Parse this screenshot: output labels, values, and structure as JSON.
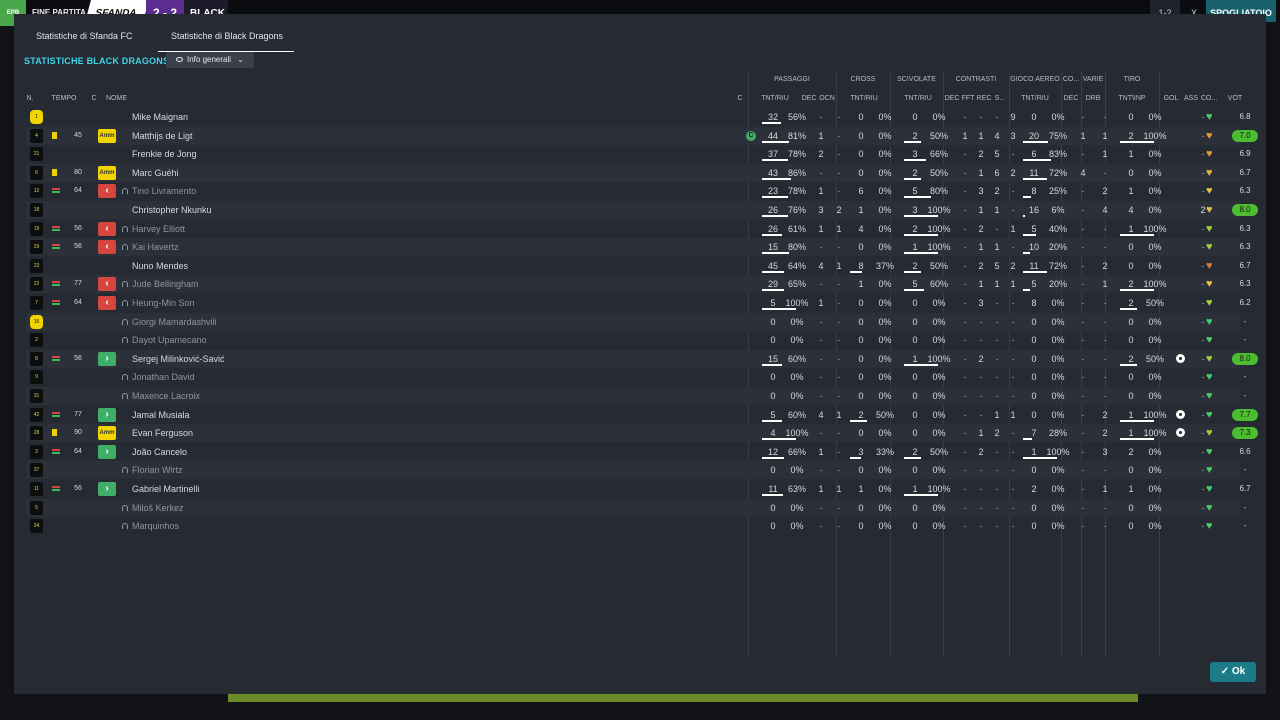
{
  "topbar": {
    "logo": "EPB",
    "status": "FINE PARTITA",
    "home": "SFANDA",
    "score": "2 - 2",
    "away": "BLACK",
    "right_score": "1-2",
    "right_x": "X",
    "right_button": "SPOGLIATOIO"
  },
  "tabs": [
    {
      "label": "Statistiche di Sfanda FC"
    },
    {
      "label": "Statistiche di Black Dragons"
    }
  ],
  "team_title": "STATISTICHE BLACK DRAGONS",
  "dropdown": {
    "label": "Info generali"
  },
  "groups": [
    "PASSAGGI",
    "CROSS",
    "SCIVOLATE",
    "CONTRASTI",
    "GIOCO AEREO",
    "CO...",
    "VARIE",
    "TIRO"
  ],
  "headers": [
    "N.",
    "TEMPO",
    "C",
    "NOME",
    "C",
    "TNT/RIU",
    "DEC",
    "OCN",
    "TNT/RIU",
    "TNT/RIU",
    "DEC",
    "FFT",
    "REC",
    "S...",
    "TNT/RIU",
    "DEC",
    "DRB",
    "TNT\\INP",
    "GOL",
    "ASS",
    "CO...",
    "VOT"
  ],
  "players": [
    {
      "num": "1",
      "gk": true,
      "card": "",
      "sub": "",
      "tempo": "",
      "badge": "",
      "name": "Mike Maignan",
      "dim": false,
      "cap": false,
      "pas": [
        "32",
        "56%"
      ],
      "pasr": 0.56,
      "dec": "-",
      "ocn": "-",
      "cr": [
        "0",
        "0%"
      ],
      "crr": 0,
      "sc": [
        "0",
        "0%"
      ],
      "scr": 0,
      "cdec": "-",
      "fft": "-",
      "rec": "-",
      "s": "9",
      "ga": [
        "0",
        "0%"
      ],
      "gar": 0,
      "co": "-",
      "drb": "-",
      "ti": [
        "0",
        "0%"
      ],
      "tir": 0,
      "gol": "",
      "ass": "-",
      "heart": "#3fd06a",
      "vot": "6.8",
      "hi": false
    },
    {
      "num": "4",
      "gk": false,
      "card": "y",
      "sub": "",
      "tempo": "45",
      "badge": "amm",
      "name": "Matthijs de Ligt",
      "dim": false,
      "cap": true,
      "pas": [
        "44",
        "81%"
      ],
      "pasr": 0.81,
      "dec": "1",
      "ocn": "-",
      "cr": [
        "0",
        "0%"
      ],
      "crr": 0,
      "sc": [
        "2",
        "50%"
      ],
      "scr": 0.5,
      "cdec": "1",
      "fft": "1",
      "rec": "4",
      "s": "3",
      "ga": [
        "20",
        "75%"
      ],
      "gar": 0.75,
      "co": "1",
      "drb": "1",
      "ti": [
        "2",
        "100%"
      ],
      "tir": 1,
      "gol": "",
      "ass": "-",
      "heart": "#e39a3a",
      "vot": "7.0",
      "hi": true
    },
    {
      "num": "21",
      "gk": false,
      "card": "",
      "sub": "",
      "tempo": "",
      "badge": "",
      "name": "Frenkie de Jong",
      "dim": false,
      "cap": false,
      "pas": [
        "37",
        "78%"
      ],
      "pasr": 0.78,
      "dec": "2",
      "ocn": "-",
      "cr": [
        "0",
        "0%"
      ],
      "crr": 0,
      "sc": [
        "3",
        "66%"
      ],
      "scr": 0.66,
      "cdec": "-",
      "fft": "2",
      "rec": "5",
      "s": "-",
      "ga": [
        "6",
        "83%"
      ],
      "gar": 0.83,
      "co": "-",
      "drb": "1",
      "ti": [
        "1",
        "0%"
      ],
      "tir": 0,
      "gol": "",
      "ass": "-",
      "heart": "#e39a3a",
      "vot": "6.9",
      "hi": false
    },
    {
      "num": "6",
      "gk": false,
      "card": "y",
      "sub": "",
      "tempo": "80",
      "badge": "amm",
      "name": "Marc Guéhi",
      "dim": false,
      "cap": false,
      "pas": [
        "43",
        "86%"
      ],
      "pasr": 0.86,
      "dec": "-",
      "ocn": "-",
      "cr": [
        "0",
        "0%"
      ],
      "crr": 0,
      "sc": [
        "2",
        "50%"
      ],
      "scr": 0.5,
      "cdec": "-",
      "fft": "1",
      "rec": "6",
      "s": "2",
      "ga": [
        "11",
        "72%"
      ],
      "gar": 0.72,
      "co": "4",
      "drb": "-",
      "ti": [
        "0",
        "0%"
      ],
      "tir": 0,
      "gol": "",
      "ass": "-",
      "heart": "#e3b23a",
      "vot": "6.7",
      "hi": false
    },
    {
      "num": "12",
      "gk": false,
      "card": "",
      "sub": "s",
      "tempo": "64",
      "badge": "out",
      "name": "Tino Livramento",
      "dim": true,
      "cap": false,
      "pas": [
        "23",
        "78%"
      ],
      "pasr": 0.78,
      "dec": "1",
      "ocn": "-",
      "cr": [
        "6",
        "0%"
      ],
      "crr": 0,
      "sc": [
        "5",
        "80%"
      ],
      "scr": 0.8,
      "cdec": "-",
      "fft": "3",
      "rec": "2",
      "s": "-",
      "ga": [
        "8",
        "25%"
      ],
      "gar": 0.25,
      "co": "-",
      "drb": "2",
      "ti": [
        "1",
        "0%"
      ],
      "tir": 0,
      "gol": "",
      "ass": "-",
      "heart": "#e3c23a",
      "vot": "6.3",
      "hi": false
    },
    {
      "num": "18",
      "gk": false,
      "card": "",
      "sub": "",
      "tempo": "",
      "badge": "",
      "name": "Christopher Nkunku",
      "dim": false,
      "cap": false,
      "pas": [
        "26",
        "76%"
      ],
      "pasr": 0.76,
      "dec": "3",
      "ocn": "2",
      "cr": [
        "1",
        "0%"
      ],
      "crr": 0,
      "sc": [
        "3",
        "100%"
      ],
      "scr": 1,
      "cdec": "-",
      "fft": "1",
      "rec": "1",
      "s": "-",
      "ga": [
        "16",
        "6%"
      ],
      "gar": 0.06,
      "co": "-",
      "drb": "4",
      "ti": [
        "4",
        "0%"
      ],
      "tir": 0,
      "gol": "",
      "ass": "2",
      "heart": "#e3c23a",
      "vot": "8.0",
      "hi": true
    },
    {
      "num": "19",
      "gk": false,
      "card": "",
      "sub": "s",
      "tempo": "56",
      "badge": "out",
      "name": "Harvey Elliott",
      "dim": true,
      "cap": false,
      "pas": [
        "26",
        "61%"
      ],
      "pasr": 0.61,
      "dec": "1",
      "ocn": "1",
      "cr": [
        "4",
        "0%"
      ],
      "crr": 0,
      "sc": [
        "2",
        "100%"
      ],
      "scr": 1,
      "cdec": "-",
      "fft": "2",
      "rec": "-",
      "s": "1",
      "ga": [
        "5",
        "40%"
      ],
      "gar": 0.4,
      "co": "-",
      "drb": "-",
      "ti": [
        "1",
        "100%"
      ],
      "tir": 1,
      "gol": "",
      "ass": "-",
      "heart": "#9ed23a",
      "vot": "6.3",
      "hi": false
    },
    {
      "num": "29",
      "gk": false,
      "card": "",
      "sub": "s",
      "tempo": "56",
      "badge": "out",
      "name": "Kai Havertz",
      "dim": true,
      "cap": false,
      "pas": [
        "15",
        "80%"
      ],
      "pasr": 0.8,
      "dec": "-",
      "ocn": "-",
      "cr": [
        "0",
        "0%"
      ],
      "crr": 0,
      "sc": [
        "1",
        "100%"
      ],
      "scr": 1,
      "cdec": "-",
      "fft": "1",
      "rec": "1",
      "s": "-",
      "ga": [
        "10",
        "20%"
      ],
      "gar": 0.2,
      "co": "-",
      "drb": "-",
      "ti": [
        "0",
        "0%"
      ],
      "tir": 0,
      "gol": "",
      "ass": "-",
      "heart": "#9ed23a",
      "vot": "6.3",
      "hi": false
    },
    {
      "num": "23",
      "gk": false,
      "card": "",
      "sub": "",
      "tempo": "",
      "badge": "",
      "name": "Nuno Mendes",
      "dim": false,
      "cap": false,
      "pas": [
        "45",
        "64%"
      ],
      "pasr": 0.64,
      "dec": "4",
      "ocn": "1",
      "cr": [
        "8",
        "37%"
      ],
      "crr": 0.37,
      "sc": [
        "2",
        "50%"
      ],
      "scr": 0.5,
      "cdec": "-",
      "fft": "2",
      "rec": "5",
      "s": "2",
      "ga": [
        "11",
        "72%"
      ],
      "gar": 0.72,
      "co": "-",
      "drb": "2",
      "ti": [
        "0",
        "0%"
      ],
      "tir": 0,
      "gol": "",
      "ass": "-",
      "heart": "#d27a3a",
      "vot": "6.7",
      "hi": false
    },
    {
      "num": "22",
      "gk": false,
      "card": "",
      "sub": "s",
      "tempo": "77",
      "badge": "out",
      "name": "Jude Bellingham",
      "dim": true,
      "cap": false,
      "pas": [
        "29",
        "65%"
      ],
      "pasr": 0.65,
      "dec": "-",
      "ocn": "-",
      "cr": [
        "1",
        "0%"
      ],
      "crr": 0,
      "sc": [
        "5",
        "60%"
      ],
      "scr": 0.6,
      "cdec": "-",
      "fft": "1",
      "rec": "1",
      "s": "1",
      "ga": [
        "5",
        "20%"
      ],
      "gar": 0.2,
      "co": "-",
      "drb": "1",
      "ti": [
        "2",
        "100%"
      ],
      "tir": 1,
      "gol": "",
      "ass": "-",
      "heart": "#e3c23a",
      "vot": "6.3",
      "hi": false
    },
    {
      "num": "7",
      "gk": false,
      "card": "",
      "sub": "s",
      "tempo": "64",
      "badge": "out",
      "name": "Heung-Min Son",
      "dim": true,
      "cap": false,
      "pas": [
        "5",
        "100%"
      ],
      "pasr": 1,
      "dec": "1",
      "ocn": "-",
      "cr": [
        "0",
        "0%"
      ],
      "crr": 0,
      "sc": [
        "0",
        "0%"
      ],
      "scr": 0,
      "cdec": "-",
      "fft": "3",
      "rec": "-",
      "s": "-",
      "ga": [
        "8",
        "0%"
      ],
      "gar": 0,
      "co": "-",
      "drb": "-",
      "ti": [
        "2",
        "50%"
      ],
      "tir": 0.5,
      "gol": "",
      "ass": "-",
      "heart": "#9ed23a",
      "vot": "6.2",
      "hi": false
    },
    {
      "num": "16",
      "gk": true,
      "card": "",
      "sub": "",
      "tempo": "",
      "badge": "",
      "name": "Giorgi Mamardashvili",
      "dim": true,
      "cap": false,
      "pas": [
        "0",
        "0%"
      ],
      "pasr": 0,
      "dec": "-",
      "ocn": "-",
      "cr": [
        "0",
        "0%"
      ],
      "crr": 0,
      "sc": [
        "0",
        "0%"
      ],
      "scr": 0,
      "cdec": "-",
      "fft": "-",
      "rec": "-",
      "s": "-",
      "ga": [
        "0",
        "0%"
      ],
      "gar": 0,
      "co": "-",
      "drb": "-",
      "ti": [
        "0",
        "0%"
      ],
      "tir": 0,
      "gol": "",
      "ass": "-",
      "heart": "#3fd06a",
      "vot": "-",
      "hi": false
    },
    {
      "num": "2",
      "gk": false,
      "card": "",
      "sub": "",
      "tempo": "",
      "badge": "",
      "name": "Dayot Upamecano",
      "dim": true,
      "cap": false,
      "pas": [
        "0",
        "0%"
      ],
      "pasr": 0,
      "dec": "-",
      "ocn": "-",
      "cr": [
        "0",
        "0%"
      ],
      "crr": 0,
      "sc": [
        "0",
        "0%"
      ],
      "scr": 0,
      "cdec": "-",
      "fft": "-",
      "rec": "-",
      "s": "-",
      "ga": [
        "0",
        "0%"
      ],
      "gar": 0,
      "co": "-",
      "drb": "-",
      "ti": [
        "0",
        "0%"
      ],
      "tir": 0,
      "gol": "",
      "ass": "-",
      "heart": "#3fd06a",
      "vot": "-",
      "hi": false
    },
    {
      "num": "8",
      "gk": false,
      "card": "",
      "sub": "i",
      "tempo": "56",
      "badge": "in",
      "name": "Sergej Milinković-Savić",
      "dim": false,
      "cap": false,
      "pas": [
        "15",
        "60%"
      ],
      "pasr": 0.6,
      "dec": "-",
      "ocn": "-",
      "cr": [
        "0",
        "0%"
      ],
      "crr": 0,
      "sc": [
        "1",
        "100%"
      ],
      "scr": 1,
      "cdec": "-",
      "fft": "2",
      "rec": "-",
      "s": "-",
      "ga": [
        "0",
        "0%"
      ],
      "gar": 0,
      "co": "-",
      "drb": "-",
      "ti": [
        "2",
        "50%"
      ],
      "tir": 0.5,
      "gol": "1",
      "ass": "-",
      "heart": "#9ed23a",
      "vot": "8.0",
      "hi": true
    },
    {
      "num": "9",
      "gk": false,
      "card": "",
      "sub": "",
      "tempo": "",
      "badge": "",
      "name": "Jonathan David",
      "dim": true,
      "cap": false,
      "pas": [
        "0",
        "0%"
      ],
      "pasr": 0,
      "dec": "-",
      "ocn": "-",
      "cr": [
        "0",
        "0%"
      ],
      "crr": 0,
      "sc": [
        "0",
        "0%"
      ],
      "scr": 0,
      "cdec": "-",
      "fft": "-",
      "rec": "-",
      "s": "-",
      "ga": [
        "0",
        "0%"
      ],
      "gar": 0,
      "co": "-",
      "drb": "-",
      "ti": [
        "0",
        "0%"
      ],
      "tir": 0,
      "gol": "",
      "ass": "-",
      "heart": "#3fd06a",
      "vot": "-",
      "hi": false
    },
    {
      "num": "31",
      "gk": false,
      "card": "",
      "sub": "",
      "tempo": "",
      "badge": "",
      "name": "Maxence Lacroix",
      "dim": true,
      "cap": false,
      "pas": [
        "0",
        "0%"
      ],
      "pasr": 0,
      "dec": "-",
      "ocn": "-",
      "cr": [
        "0",
        "0%"
      ],
      "crr": 0,
      "sc": [
        "0",
        "0%"
      ],
      "scr": 0,
      "cdec": "-",
      "fft": "-",
      "rec": "-",
      "s": "-",
      "ga": [
        "0",
        "0%"
      ],
      "gar": 0,
      "co": "-",
      "drb": "-",
      "ti": [
        "0",
        "0%"
      ],
      "tir": 0,
      "gol": "",
      "ass": "-",
      "heart": "#3fd06a",
      "vot": "-",
      "hi": false
    },
    {
      "num": "42",
      "gk": false,
      "card": "",
      "sub": "i",
      "tempo": "77",
      "badge": "in",
      "name": "Jamal Musiala",
      "dim": false,
      "cap": false,
      "pas": [
        "5",
        "60%"
      ],
      "pasr": 0.6,
      "dec": "4",
      "ocn": "1",
      "cr": [
        "2",
        "50%"
      ],
      "crr": 0.5,
      "sc": [
        "0",
        "0%"
      ],
      "scr": 0,
      "cdec": "-",
      "fft": "-",
      "rec": "1",
      "s": "1",
      "ga": [
        "0",
        "0%"
      ],
      "gar": 0,
      "co": "-",
      "drb": "2",
      "ti": [
        "1",
        "100%"
      ],
      "tir": 1,
      "gol": "1",
      "ass": "-",
      "heart": "#3fd06a",
      "vot": "7.7",
      "hi": true
    },
    {
      "num": "28",
      "gk": false,
      "card": "y",
      "sub": "",
      "tempo": "90",
      "badge": "amm",
      "name": "Evan Ferguson",
      "dim": false,
      "cap": false,
      "pas": [
        "4",
        "100%"
      ],
      "pasr": 1,
      "dec": "-",
      "ocn": "-",
      "cr": [
        "0",
        "0%"
      ],
      "crr": 0,
      "sc": [
        "0",
        "0%"
      ],
      "scr": 0,
      "cdec": "-",
      "fft": "1",
      "rec": "2",
      "s": "-",
      "ga": [
        "7",
        "28%"
      ],
      "gar": 0.28,
      "co": "-",
      "drb": "2",
      "ti": [
        "1",
        "100%"
      ],
      "tir": 1,
      "gol": "1",
      "ass": "-",
      "heart": "#9ed23a",
      "vot": "7.3",
      "hi": true
    },
    {
      "num": "3",
      "gk": false,
      "card": "",
      "sub": "i",
      "tempo": "64",
      "badge": "in",
      "name": "João Cancelo",
      "dim": false,
      "cap": false,
      "pas": [
        "12",
        "66%"
      ],
      "pasr": 0.66,
      "dec": "1",
      "ocn": "-",
      "cr": [
        "3",
        "33%"
      ],
      "crr": 0.33,
      "sc": [
        "2",
        "50%"
      ],
      "scr": 0.5,
      "cdec": "-",
      "fft": "2",
      "rec": "-",
      "s": "-",
      "ga": [
        "1",
        "100%"
      ],
      "gar": 1,
      "co": "-",
      "drb": "3",
      "ti": [
        "2",
        "0%"
      ],
      "tir": 0,
      "gol": "",
      "ass": "-",
      "heart": "#3fd06a",
      "vot": "6.6",
      "hi": false
    },
    {
      "num": "37",
      "gk": false,
      "card": "",
      "sub": "",
      "tempo": "",
      "badge": "",
      "name": "Florian Wirtz",
      "dim": true,
      "cap": false,
      "pas": [
        "0",
        "0%"
      ],
      "pasr": 0,
      "dec": "-",
      "ocn": "-",
      "cr": [
        "0",
        "0%"
      ],
      "crr": 0,
      "sc": [
        "0",
        "0%"
      ],
      "scr": 0,
      "cdec": "-",
      "fft": "-",
      "rec": "-",
      "s": "-",
      "ga": [
        "0",
        "0%"
      ],
      "gar": 0,
      "co": "-",
      "drb": "-",
      "ti": [
        "0",
        "0%"
      ],
      "tir": 0,
      "gol": "",
      "ass": "-",
      "heart": "#3fd06a",
      "vot": "-",
      "hi": false
    },
    {
      "num": "11",
      "gk": false,
      "card": "",
      "sub": "i",
      "tempo": "56",
      "badge": "in",
      "name": "Gabriel Martinelli",
      "dim": false,
      "cap": false,
      "pas": [
        "11",
        "63%"
      ],
      "pasr": 0.63,
      "dec": "1",
      "ocn": "1",
      "cr": [
        "1",
        "0%"
      ],
      "crr": 0,
      "sc": [
        "1",
        "100%"
      ],
      "scr": 1,
      "cdec": "-",
      "fft": "-",
      "rec": "-",
      "s": "-",
      "ga": [
        "2",
        "0%"
      ],
      "gar": 0,
      "co": "-",
      "drb": "1",
      "ti": [
        "1",
        "0%"
      ],
      "tir": 0,
      "gol": "",
      "ass": "-",
      "heart": "#3fd06a",
      "vot": "6.7",
      "hi": false
    },
    {
      "num": "5",
      "gk": false,
      "card": "",
      "sub": "",
      "tempo": "",
      "badge": "",
      "name": "Miloš Kerkez",
      "dim": true,
      "cap": false,
      "pas": [
        "0",
        "0%"
      ],
      "pasr": 0,
      "dec": "-",
      "ocn": "-",
      "cr": [
        "0",
        "0%"
      ],
      "crr": 0,
      "sc": [
        "0",
        "0%"
      ],
      "scr": 0,
      "cdec": "-",
      "fft": "-",
      "rec": "-",
      "s": "-",
      "ga": [
        "0",
        "0%"
      ],
      "gar": 0,
      "co": "-",
      "drb": "-",
      "ti": [
        "0",
        "0%"
      ],
      "tir": 0,
      "gol": "",
      "ass": "-",
      "heart": "#3fd06a",
      "vot": "-",
      "hi": false
    },
    {
      "num": "34",
      "gk": false,
      "card": "",
      "sub": "",
      "tempo": "",
      "badge": "",
      "name": "Marquinhos",
      "dim": true,
      "cap": false,
      "pas": [
        "0",
        "0%"
      ],
      "pasr": 0,
      "dec": "-",
      "ocn": "-",
      "cr": [
        "0",
        "0%"
      ],
      "crr": 0,
      "sc": [
        "0",
        "0%"
      ],
      "scr": 0,
      "cdec": "-",
      "fft": "-",
      "rec": "-",
      "s": "-",
      "ga": [
        "0",
        "0%"
      ],
      "gar": 0,
      "co": "-",
      "drb": "-",
      "ti": [
        "0",
        "0%"
      ],
      "tir": 0,
      "gol": "",
      "ass": "-",
      "heart": "#3fd06a",
      "vot": "-",
      "hi": false
    }
  ],
  "badge_labels": {
    "amm": "Amm",
    "out": "‹",
    "in": "›"
  },
  "captain_label": "C",
  "ok_label": "Ok"
}
